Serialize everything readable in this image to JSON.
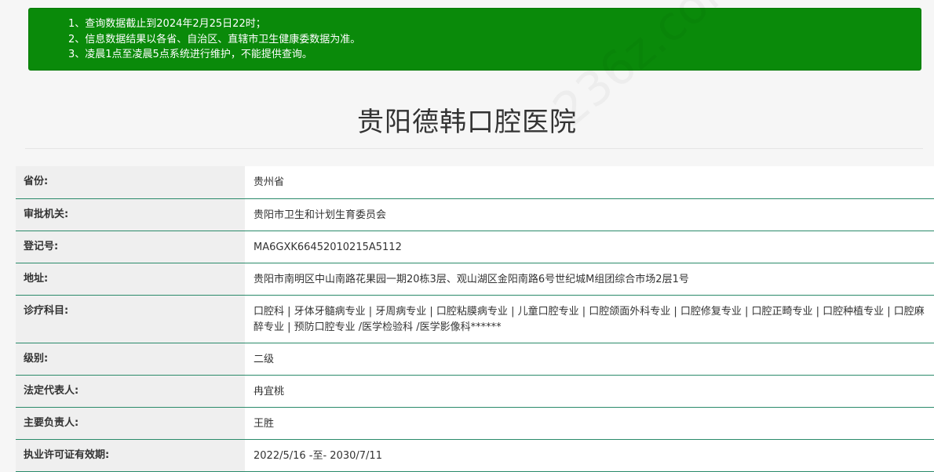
{
  "notice": {
    "lines": [
      "1、查询数据截止到2024年2月25日22时；",
      "2、信息数据结果以各省、自治区、直辖市卫生健康委数据为准。",
      "3、凌晨1点至凌晨5点系统进行维护，不能提供查询。"
    ],
    "background_color": "#0a8a0a"
  },
  "page": {
    "title": "贵阳德韩口腔医院"
  },
  "watermark_text": "236z.com",
  "rows": [
    {
      "label": "省份:",
      "value": "贵州省"
    },
    {
      "label": "审批机关:",
      "value": "贵阳市卫生和计划生育委员会"
    },
    {
      "label": "登记号:",
      "value": "MA6GXK66452010215A5112"
    },
    {
      "label": "地址:",
      "value": "贵阳市南明区中山南路花果园一期20栋3层、观山湖区金阳南路6号世纪城M组团综合市场2层1号"
    },
    {
      "label": "诊疗科目:",
      "value": "口腔科 | 牙体牙髓病专业 | 牙周病专业 | 口腔粘膜病专业 | 儿童口腔专业 | 口腔颌面外科专业 | 口腔修复专业 | 口腔正畸专业 | 口腔种植专业 | 口腔麻醉专业 | 预防口腔专业 /医学检验科 /医学影像科******"
    },
    {
      "label": "级别:",
      "value": "二级"
    },
    {
      "label": "法定代表人:",
      "value": "冉宜桃"
    },
    {
      "label": "主要负责人:",
      "value": "王胜"
    },
    {
      "label": "执业许可证有效期:",
      "value": "2022/5/16 -至- 2030/7/11"
    }
  ],
  "row_border_color": "#2a8a6a"
}
